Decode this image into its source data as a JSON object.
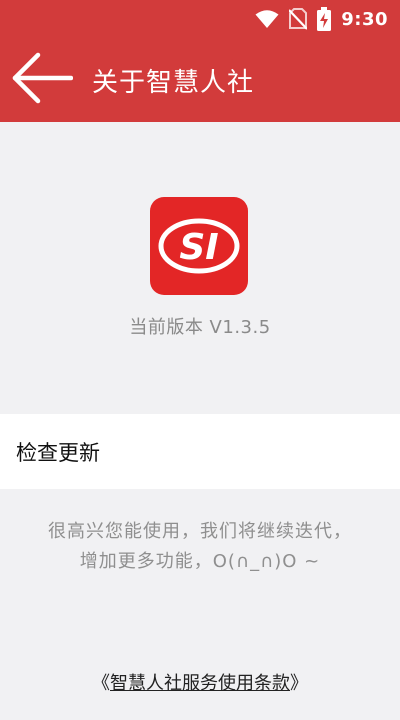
{
  "status_bar": {
    "time": "9:30",
    "icons": [
      "wifi-icon",
      "no-sim-icon",
      "battery-charging-icon"
    ]
  },
  "app_bar": {
    "back_icon": "arrow-left-icon",
    "title": "关于智慧人社"
  },
  "logo": {
    "text": "SI",
    "color": "#e32626"
  },
  "version_text": "当前版本 V1.3.5",
  "check_update_label": "检查更新",
  "message": {
    "line1": "很高兴您能使用，我们将继续迭代，",
    "line2": "增加更多功能，O(∩_∩)O ~"
  },
  "terms": {
    "open": "《",
    "link": "智慧人社服务使用条款",
    "close": "》"
  },
  "colors": {
    "primary": "#d23b3b",
    "background": "#f1f1f3"
  }
}
